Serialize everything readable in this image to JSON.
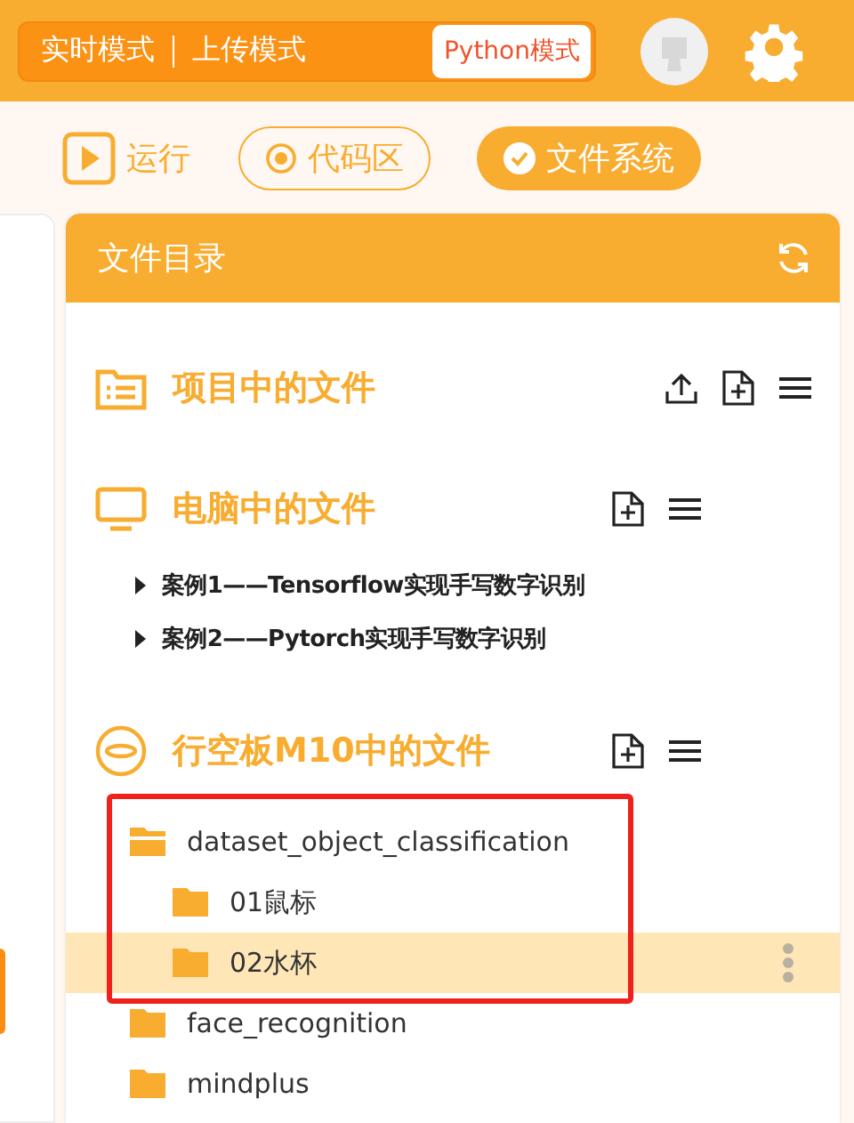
{
  "mode_switch": [
    {
      "label": "实时模式",
      "selected": false
    },
    {
      "label": "上传模式",
      "selected": false
    },
    {
      "label": "Python模式",
      "selected": true
    }
  ],
  "toolbar": [
    {
      "label": "运行",
      "kind": "run",
      "selected": false
    },
    {
      "label": "代码区",
      "kind": "code",
      "selected": false
    },
    {
      "label": "文件系统",
      "kind": "files",
      "selected": true
    }
  ],
  "panel": {
    "title": "文件目录"
  },
  "sections": [
    {
      "title": "项目中的文件",
      "kind": "project",
      "upload": true
    },
    {
      "title": "电脑中的文件",
      "kind": "computer",
      "upload": false,
      "items": [
        {
          "label": "案例1——Tensorflow实现手写数字识别",
          "kind": "case",
          "expanded": false
        },
        {
          "label": "案例2——Pytorch实现手写数字识别",
          "kind": "case",
          "expanded": false
        }
      ]
    },
    {
      "title": "行空板M10中的文件",
      "kind": "board",
      "upload": false,
      "items": [
        {
          "label": "dataset_object_classification",
          "expanded": true,
          "selected": false,
          "framed": true,
          "children": [
            {
              "label": "01鼠标",
              "expanded": false,
              "selected": false,
              "framed": true
            },
            {
              "label": "02水杯",
              "expanded": false,
              "selected": true,
              "framed": true
            }
          ]
        },
        {
          "label": "face_recognition",
          "expanded": false,
          "selected": false,
          "framed": false
        },
        {
          "label": "mindplus",
          "expanded": false,
          "selected": false,
          "framed": false
        }
      ]
    }
  ]
}
